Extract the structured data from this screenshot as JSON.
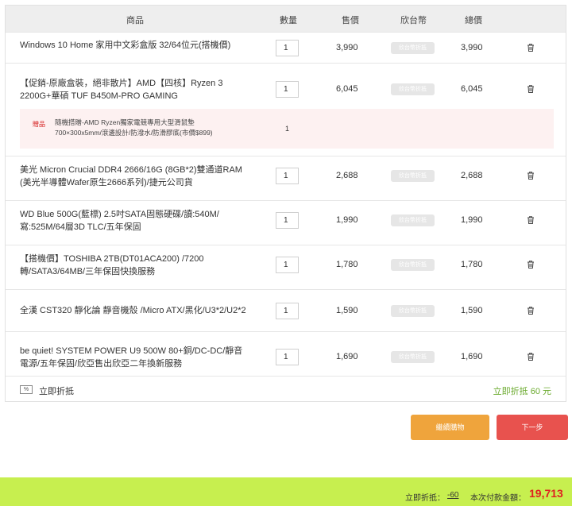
{
  "header": {
    "product": "商品",
    "quantity": "數量",
    "price": "售價",
    "coin": "欣台幣",
    "total": "總價"
  },
  "coin_button_label": "欣台幣折抵",
  "items": [
    {
      "name": "Windows 10 Home 家用中文彩盒版 32/64位元(搭機價)",
      "qty": "1",
      "price": "3,990",
      "total": "3,990"
    },
    {
      "name": "【促銷-原廠盒裝，絕非散片】AMD【四核】Ryzen 3 2200G+華碩 TUF B450M-PRO GAMING",
      "qty": "1",
      "price": "6,045",
      "total": "6,045"
    },
    {
      "name": "美光 Micron Crucial DDR4 2666/16G (8GB*2)雙通道RAM (美光半導體Wafer原生2666系列)/捷元公司貨",
      "qty": "1",
      "price": "2,688",
      "total": "2,688"
    },
    {
      "name": "WD Blue 500G(藍標) 2.5吋SATA固態硬碟/讀:540M/寫:525M/64層3D TLC/五年保固",
      "qty": "1",
      "price": "1,990",
      "total": "1,990"
    },
    {
      "name": "【搭機價】TOSHIBA 2TB(DT01ACA200) /7200轉/SATA3/64MB/三年保固快換服務",
      "qty": "1",
      "price": "1,780",
      "total": "1,780"
    },
    {
      "name": "全漢 CST320 靜化論 靜音機殼 /Micro ATX/黑化/U3*2/U2*2",
      "qty": "1",
      "price": "1,590",
      "total": "1,590"
    },
    {
      "name": "be quiet! SYSTEM POWER U9 500W 80+銅/DC-DC/靜音電源/五年保固/欣亞售出欣亞二年換新服務",
      "qty": "1",
      "price": "1,690",
      "total": "1,690"
    }
  ],
  "gift": {
    "tag": "贈品",
    "line1": "隨機搭贈-AMD Ryzen獨家電競專用大型滑鼠墊",
    "line2": "700×300x5mm/滾邊設計/防潑水/防滑膠底(市價$899)",
    "qty": "1"
  },
  "discount": {
    "icon_text": "%",
    "label": "立即折抵",
    "amount": "立即折抵 60 元"
  },
  "buttons": {
    "continue": "繼續購物",
    "next": "下一步"
  },
  "footer": {
    "discount_label": "立即折抵：",
    "discount_value": "-60",
    "pay_label": "本次付款金額：",
    "pay_value": "19,713"
  },
  "colors": {
    "footer_bg": "#c7ef4f",
    "continue_btn": "#efa43c",
    "next_btn": "#e8524e",
    "discount_green": "#6aaa2d",
    "pay_red": "#e02020"
  }
}
